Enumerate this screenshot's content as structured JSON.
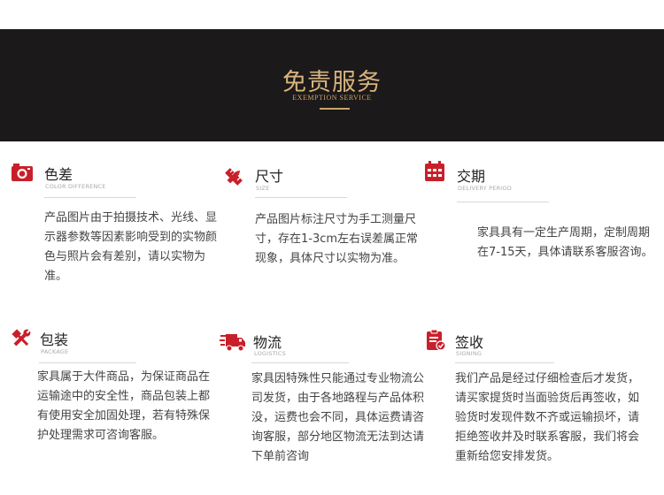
{
  "header": {
    "title": "免责服务",
    "subtitle": "EXEMPTION SERVICE"
  },
  "items": [
    {
      "title": "色差",
      "subtitle": "COLOR DIFFERENCE",
      "icon": "camera-icon",
      "body": "产品图片由于拍摄技术、光线、显示器参数等因素影响受到的实物颜色与照片会有差别，请以实物为准。"
    },
    {
      "title": "尺寸",
      "subtitle": "SIZE",
      "icon": "ruler-pencil-icon",
      "body": "产品图片标注尺寸为手工测量尺寸，存在1-3cm左右误差属正常现象，具体尺寸以实物为准。"
    },
    {
      "title": "交期",
      "subtitle": "DELIVERY PERIOD",
      "icon": "calendar-icon",
      "body": "家具具有一定生产周期，定制周期在7-15天，具体请联系客服咨询。"
    },
    {
      "title": "包装",
      "subtitle": "PACKAGE",
      "icon": "tools-icon",
      "body": "家具属于大件商品，为保证商品在运输途中的安全性，商品包装上都有使用安全加固处理，若有特殊保护处理需求可咨询客服。"
    },
    {
      "title": "物流",
      "subtitle": "LOGISTICS",
      "icon": "truck-icon",
      "body": "家具因特殊性只能通过专业物流公司发货，由于各地路程与产品体积没，运费也会不同，具体运费请咨询客服，部分地区物流无法到达请下单前咨询"
    },
    {
      "title": "签收",
      "subtitle": "SIGNING",
      "icon": "clipboard-check-icon",
      "body": "我们产品是经过仔细检查后才发货，请买家提货时当面验货后再签收，如验货时发现件数不齐或运输损坏，请拒绝签收并及时联系客服，我们将会重新给您安排发货。"
    }
  ],
  "colors": {
    "accent": "#c8202a",
    "gold": "#d9b47e",
    "banner": "#1b1919"
  }
}
